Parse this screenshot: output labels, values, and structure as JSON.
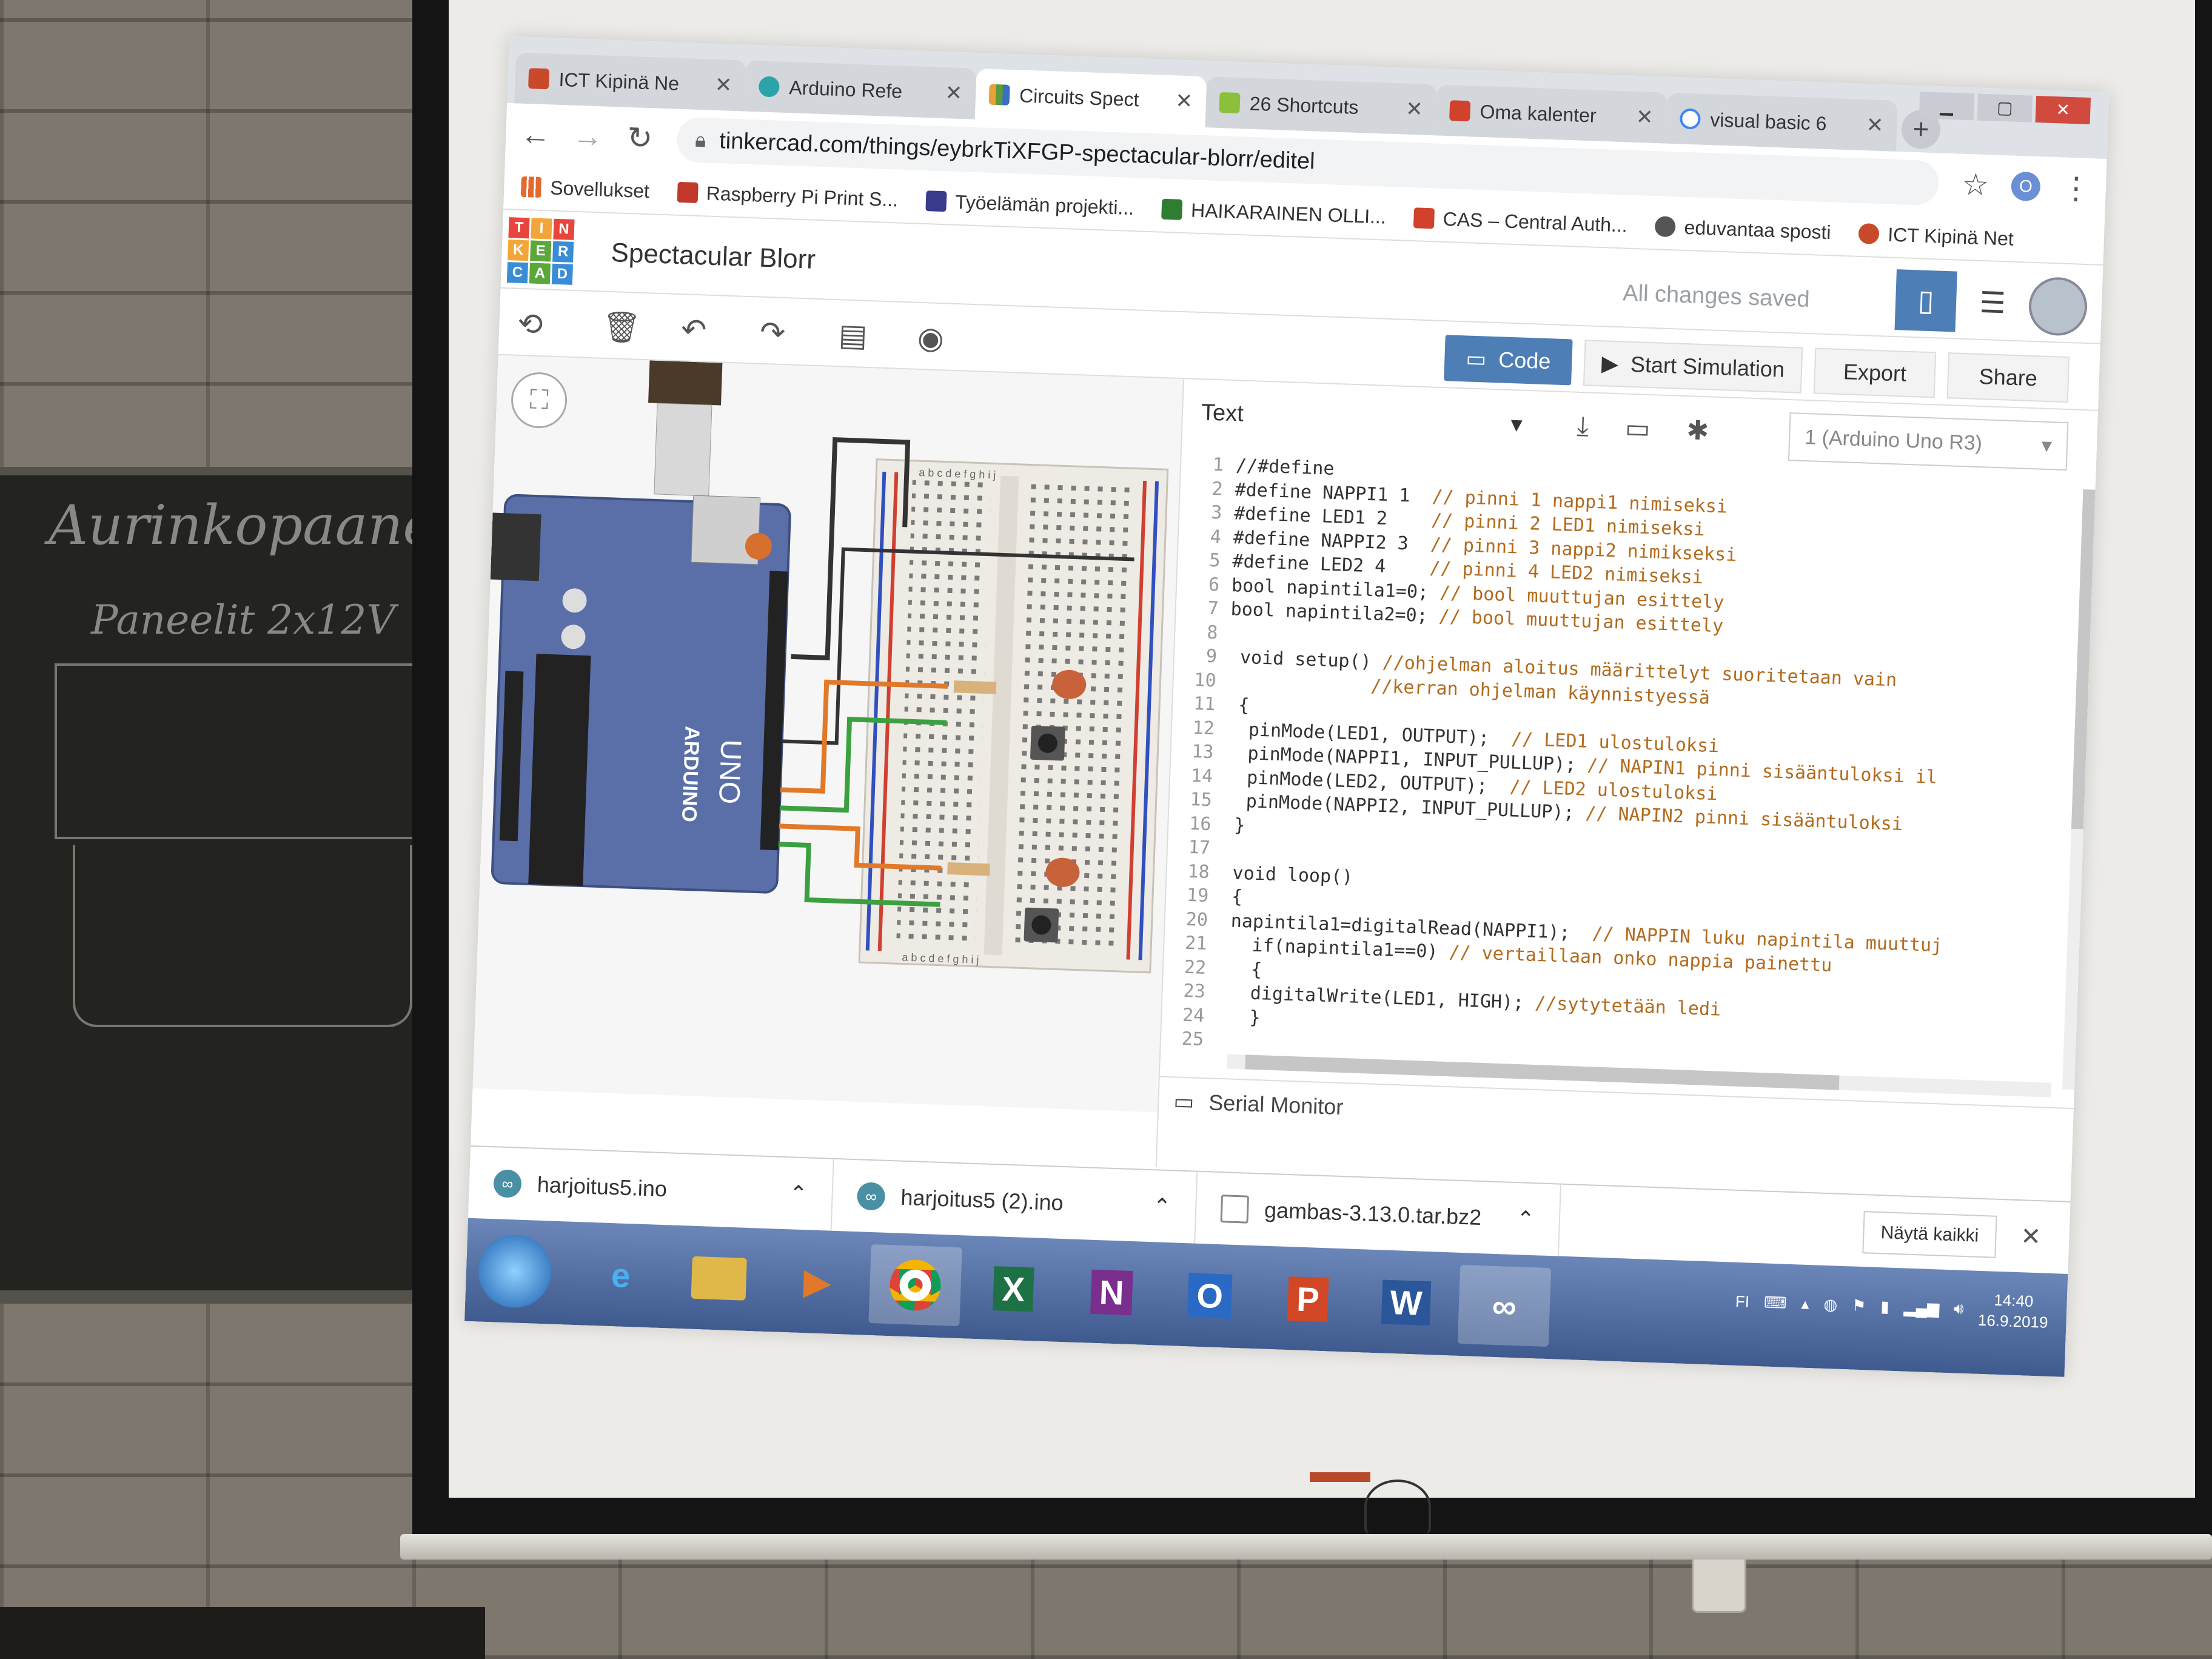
{
  "room": {
    "chalkboard_line1": "Aurinkopaaneli",
    "chalkboard_line2": "Paneelit 2x12V"
  },
  "browser": {
    "tabs": [
      {
        "label": "ICT Kipinä Ne",
        "icon": "ict-favicon",
        "color": "#c94a2a"
      },
      {
        "label": "Arduino Refe",
        "icon": "arduino-favicon",
        "color": "#2aa4a8"
      },
      {
        "label": "Circuits Spect",
        "icon": "tinkercad-favicon",
        "color": "#e8a13a"
      },
      {
        "label": "26 Shortcuts",
        "icon": "shortcut-favicon",
        "color": "#8bbf3c"
      },
      {
        "label": "Oma kalenter",
        "icon": "s-favicon",
        "color": "#d0422c"
      },
      {
        "label": "visual basic 6",
        "icon": "google-favicon",
        "color": "#4285f4"
      }
    ],
    "new_tab": "+",
    "url": "tinkercad.com/things/eybrkTiXFGP-spectacular-blorr/editel",
    "bookmarks": [
      {
        "label": "Sovellukset",
        "color": "#e36a2e"
      },
      {
        "label": "Raspberry Pi Print S...",
        "color": "#c0392b"
      },
      {
        "label": "Työelämän projekti...",
        "color": "#3a3a8c"
      },
      {
        "label": "HAIKARAINEN OLLI...",
        "color": "#2e7d32"
      },
      {
        "label": "CAS – Central Auth...",
        "color": "#d0422c"
      },
      {
        "label": "eduvantaa sposti",
        "color": "#555555"
      },
      {
        "label": "ICT Kipinä Net",
        "color": "#c94a2a"
      }
    ],
    "profile_initial": "O"
  },
  "tinkercad": {
    "logo_letters": [
      "T",
      "I",
      "N",
      "K",
      "E",
      "R",
      "C",
      "A",
      "D"
    ],
    "project_title": "Spectacular Blorr",
    "save_status": "All changes saved",
    "toolbar": {
      "code_label": "Code",
      "start_sim_label": "Start Simulation",
      "export_label": "Export",
      "share_label": "Share"
    },
    "code_editor": {
      "mode": "Text",
      "board": "1 (Arduino Uno R3)",
      "serial_monitor_label": "Serial Monitor",
      "lines": [
        {
          "n": "1",
          "code": "//#define",
          "comment": ""
        },
        {
          "n": "2",
          "code": "#define NAPPI1 1  ",
          "comment": "// pinni 1 nappi1 nimiseksi"
        },
        {
          "n": "3",
          "code": "#define LED1 2    ",
          "comment": "// pinni 2 LED1 nimiseksi"
        },
        {
          "n": "4",
          "code": "#define NAPPI2 3  ",
          "comment": "// pinni 3 nappi2 nimikseksi"
        },
        {
          "n": "5",
          "code": "#define LED2 4    ",
          "comment": "// pinni 4 LED2 nimiseksi"
        },
        {
          "n": "6",
          "code": "bool napintila1=0; ",
          "comment": "// bool muuttujan esittely"
        },
        {
          "n": "7",
          "code": "bool napintila2=0; ",
          "comment": "// bool muuttujan esittely"
        },
        {
          "n": "8",
          "code": "",
          "comment": ""
        },
        {
          "n": "9",
          "code": " void setup() ",
          "comment": "//ohjelman aloitus määrittelyt suoritetaan vain"
        },
        {
          "n": "10",
          "code": "             ",
          "comment": "//kerran ohjelman käynnistyessä"
        },
        {
          "n": "11",
          "code": " {",
          "comment": ""
        },
        {
          "n": "12",
          "code": "  pinMode(LED1, OUTPUT);  ",
          "comment": "// LED1 ulostuloksi"
        },
        {
          "n": "13",
          "code": "  pinMode(NAPPI1, INPUT_PULLUP); ",
          "comment": "// NAPIN1 pinni sisääntuloksi il"
        },
        {
          "n": "14",
          "code": "  pinMode(LED2, OUTPUT);  ",
          "comment": "// LED2 ulostuloksi"
        },
        {
          "n": "15",
          "code": "  pinMode(NAPPI2, INPUT_PULLUP); ",
          "comment": "// NAPIN2 pinni sisääntuloksi"
        },
        {
          "n": "16",
          "code": " }",
          "comment": ""
        },
        {
          "n": "17",
          "code": "",
          "comment": ""
        },
        {
          "n": "18",
          "code": " void loop()",
          "comment": ""
        },
        {
          "n": "19",
          "code": " {",
          "comment": ""
        },
        {
          "n": "20",
          "code": " napintila1=digitalRead(NAPPI1);  ",
          "comment": "// NAPPIN luku napintila muuttuj"
        },
        {
          "n": "21",
          "code": "   if(napintila1==0) ",
          "comment": "// vertaillaan onko nappia painettu"
        },
        {
          "n": "22",
          "code": "   {",
          "comment": ""
        },
        {
          "n": "23",
          "code": "   digitalWrite(LED1, HIGH); ",
          "comment": "//sytytetään ledi"
        },
        {
          "n": "24",
          "code": "   }",
          "comment": ""
        },
        {
          "n": "25",
          "code": "",
          "comment": ""
        }
      ]
    },
    "circuit": {
      "board_label_1": "ARDUINO",
      "board_label_2": "UNO",
      "breadboard_cols_top": "a b c d e   f g h i j",
      "breadboard_cols_bottom": "a b c d e   f g h i j"
    }
  },
  "downloads": {
    "items": [
      {
        "name": "harjoitus5.ino"
      },
      {
        "name": "harjoitus5 (2).ino"
      },
      {
        "name": "gambas-3.13.0.tar.bz2"
      }
    ],
    "show_all": "Näytä kaikki"
  },
  "taskbar": {
    "apps": [
      {
        "label": "e",
        "color": "#2a7ad6"
      },
      {
        "label": "",
        "color": "#e0b84a"
      },
      {
        "label": "▶",
        "color": "#e07a2a"
      },
      {
        "label": "",
        "color": "#ffffff"
      },
      {
        "label": "X",
        "color": "#1e7145"
      },
      {
        "label": "N",
        "color": "#7a2e8e"
      },
      {
        "label": "O",
        "color": "#2a6ac4"
      },
      {
        "label": "P",
        "color": "#d24726"
      },
      {
        "label": "W",
        "color": "#2b579a"
      },
      {
        "label": "∞",
        "color": "#00979d"
      }
    ],
    "lang": "FI",
    "time": "14:40",
    "date": "16.9.2019"
  }
}
